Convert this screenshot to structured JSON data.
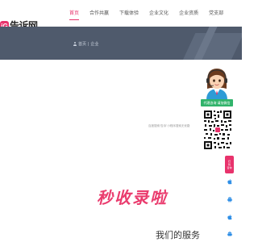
{
  "header": {
    "logo_mark": "iG",
    "logo_text": "告诉网",
    "nav": [
      "首页",
      "合作共赢",
      "下载体验",
      "企业文化",
      "企业资质",
      "党支部"
    ]
  },
  "banner": {
    "breadcrumb": [
      "首页",
      "企业"
    ]
  },
  "service": {
    "search_hint": "百度搜索“告诉”小程序搜索无忧路",
    "headline": "秒收录啦",
    "subheading": "我们的服务"
  },
  "widget": {
    "consult_label": "代理咨询 请加微信"
  },
  "sidebar": {
    "pill_lines": [
      "扫",
      "码",
      "咨询"
    ]
  },
  "colors": {
    "accent": "#e8336c",
    "banner": "#4f5a6c",
    "consult": "#31b36b"
  },
  "icons": [
    "user-icon",
    "apple-icon",
    "android-icon",
    "apple-icon",
    "android-icon"
  ]
}
